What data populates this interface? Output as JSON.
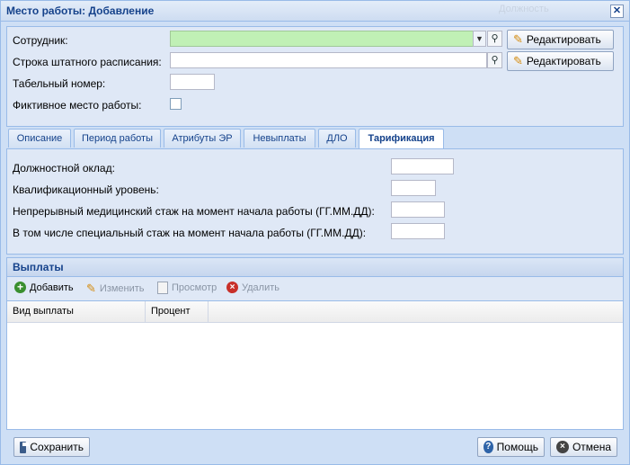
{
  "window": {
    "title": "Место работы: Добавление",
    "ghost_title": "Должность",
    "close_glyph": "✕"
  },
  "form": {
    "employee_label": "Сотрудник:",
    "staff_row_label": "Строка штатного расписания:",
    "tab_number_label": "Табельный номер:",
    "fictive_label": "Фиктивное место работы:",
    "edit_button_label": "Редактировать",
    "employee_value": "",
    "staff_row_value": "",
    "tab_number_value": "",
    "fictive_checked": false
  },
  "tabs": [
    {
      "label": "Описание",
      "active": false
    },
    {
      "label": "Период работы",
      "active": false
    },
    {
      "label": "Атрибуты ЭР",
      "active": false
    },
    {
      "label": "Невыплаты",
      "active": false
    },
    {
      "label": "ДЛО",
      "active": false
    },
    {
      "label": "Тарификация",
      "active": true
    }
  ],
  "tarification": {
    "salary_label": "Должностной оклад:",
    "qual_label": "Квалификационный уровень:",
    "continuous_label": "Непрерывный медицинский стаж на момент начала работы (ГГ.ММ.ДД):",
    "special_label": "В том числе специальный стаж на момент начала работы (ГГ.ММ.ДД):"
  },
  "payments": {
    "title": "Выплаты",
    "toolbar": {
      "add": "Добавить",
      "edit": "Изменить",
      "view": "Просмотр",
      "delete": "Удалить"
    },
    "columns": [
      "Вид выплаты",
      "Процент"
    ],
    "rows": []
  },
  "footer": {
    "save": "Сохранить",
    "help": "Помощь",
    "cancel": "Отмена"
  },
  "colors": {
    "accent": "#15428b",
    "panel": "#dfe8f6",
    "required_field": "#c0f0b5"
  }
}
